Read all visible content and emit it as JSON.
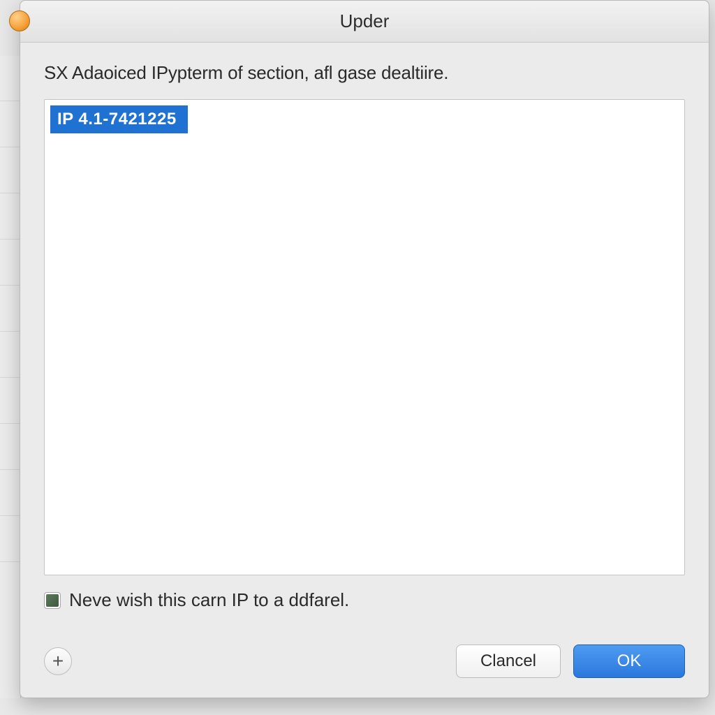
{
  "window": {
    "title": "Upder"
  },
  "description": "SX Adaoiced IPypterm of section, afl gase dealtiire.",
  "list": {
    "selected_item": "IP 4.1-7421225"
  },
  "checkbox": {
    "label": "Neve wish this carn IP to a ddfarel.",
    "checked": true
  },
  "buttons": {
    "add": "+",
    "cancel": "Clancel",
    "ok": "OK"
  },
  "background_items": [
    "",
    "",
    "",
    "",
    "",
    "",
    "",
    "",
    "",
    "",
    ""
  ]
}
